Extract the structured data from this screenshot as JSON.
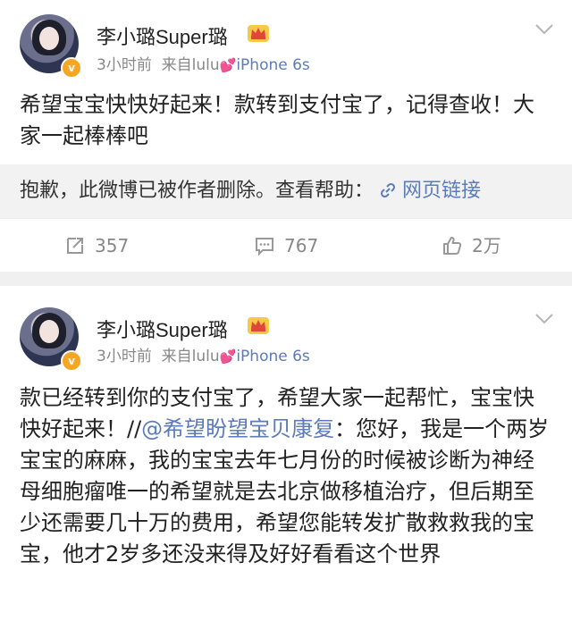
{
  "posts": [
    {
      "author": "李小璐Super璐",
      "time": "3小时前",
      "source_prefix": "来自lulu",
      "source_device": "iPhone 6s",
      "text": "希望宝宝快快好起来！款转到支付宝了，记得查收！大家一起棒棒吧",
      "deleted_notice": "抱歉，此微博已被作者删除。查看帮助：",
      "deleted_link": "网页链接",
      "reposts": "357",
      "comments": "767",
      "likes": "2万"
    },
    {
      "author": "李小璐Super璐",
      "time": "3小时前",
      "source_prefix": "来自lulu",
      "source_device": "iPhone 6s",
      "text_lead": "款已经转到你的支付宝了，希望大家一起帮忙，宝宝快快好起来！//",
      "mention": "@希望盼望宝贝康复",
      "text_tail": "：您好，我是一个两岁宝宝的麻麻，我的宝宝去年七月份的时候被诊断为神经母细胞瘤唯一的希望就是去北京做移植治疗，但后期至少还需要几十万的费用，希望您能转发扩散救救我的宝宝，他才2岁多还没来得及好好看看这个世界"
    }
  ],
  "verified_badge": "v",
  "colors": {
    "link": "#5b7bbd",
    "badge": "#f5a623",
    "heart": "#e8569a"
  },
  "icons": [
    "repost-icon",
    "comment-icon",
    "like-icon",
    "link-icon",
    "chevron-down-icon",
    "crown-icon"
  ]
}
